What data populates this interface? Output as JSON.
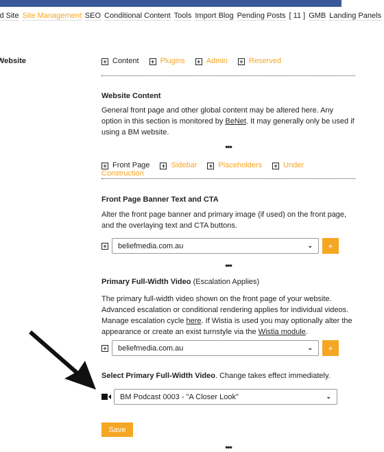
{
  "nav": {
    "items": [
      "ld Site",
      "Site Management",
      "SEO",
      "Conditional Content",
      "Tools",
      "Import Blog",
      "Pending Posts",
      "[ 11 ]",
      "GMB",
      "Landing Panels"
    ],
    "active_index": 1
  },
  "sidebar": {
    "label": "Website"
  },
  "tabs1": [
    "Content",
    "Plugins",
    "Admin",
    "Reserved"
  ],
  "website_content": {
    "title": "Website Content",
    "text_before": "General front page and other global content may be altered here. Any option in this section is monitored by ",
    "link": "BeNet",
    "text_after": ". It may generally only be used if using a BM website."
  },
  "dots": "•••",
  "tabs2": [
    "Front Page",
    "Sidebar",
    "Placeholders",
    "Under Construction"
  ],
  "banner": {
    "title": "Front Page Banner Text and CTA",
    "text": "Alter the front page banner and primary image (if used) on the front page, and the overlaying text and CTA buttons.",
    "select_value": "beliefmedia.com.au",
    "add": "+"
  },
  "video": {
    "title": "Primary Full-Width Video",
    "title_note": "(Escalation Applies)",
    "text1": "The primary full-width video shown on the front page of your website. Advanced escalation or conditional rendering applies for individual videos. Manage escalation cycle ",
    "link1": "here",
    "text2": ". If Wistia is used you may optionally alter the appearance or create an exist turnstyle via the ",
    "link2": "Wistia module",
    "text3": ".",
    "select_value": "beliefmedia.com.au",
    "add": "+"
  },
  "select_video": {
    "label_bold": "Select Primary Full-Width Video",
    "label_rest": ". Change takes effect immediately.",
    "value": "BM Podcast 0003 - \"A Closer Look\""
  },
  "save_label": "Save",
  "colors": {
    "accent": "#f5a623",
    "header": "#3b5998"
  }
}
